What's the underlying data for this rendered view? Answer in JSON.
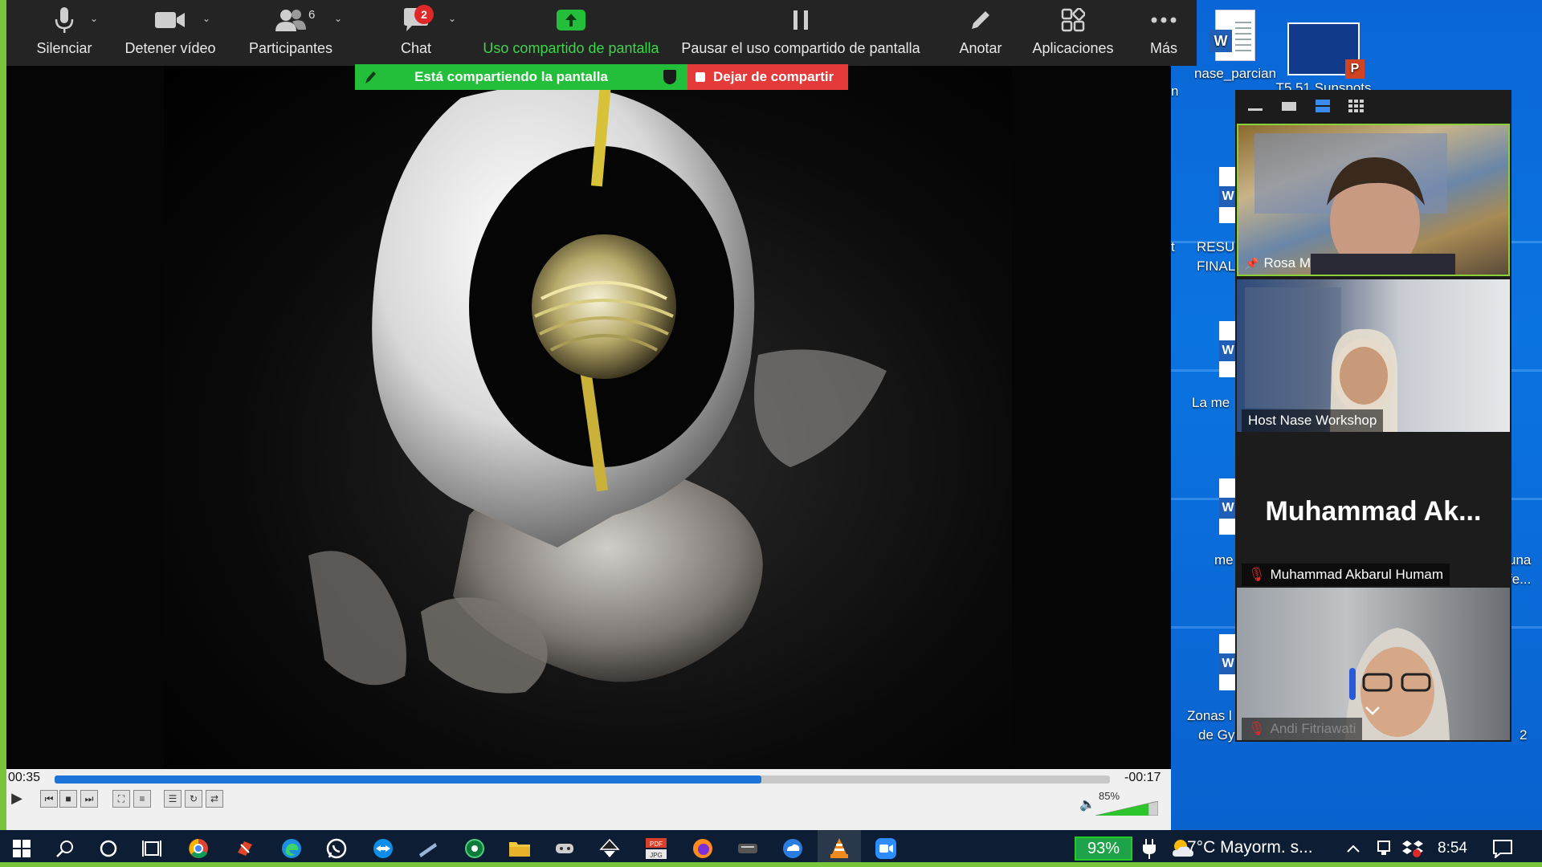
{
  "toolbar": {
    "mute": "Silenciar",
    "stop_video": "Detener vídeo",
    "participants": "Participantes",
    "participants_count": "6",
    "chat": "Chat",
    "chat_badge": "2",
    "share_screen": "Uso compartido de pantalla",
    "pause_share": "Pausar el uso compartido de pantalla",
    "annotate": "Anotar",
    "apps": "Aplicaciones",
    "more": "Más"
  },
  "share_banner": {
    "status": "Está compartiendo la pantalla",
    "stop": "Dejar de compartir"
  },
  "desktop": {
    "icon_doc": "nase_parcian",
    "icon_ppt": "T5 51 Sunspots",
    "frag_n": "n",
    "frag_resul": "RESUL",
    "frag_final": "FINAL",
    "frag_t": "t",
    "frag_la_me": "La me",
    "frag_me": "me",
    "frag_una": "una",
    "frag_fe": "fe...",
    "frag_zonas": "Zonas l",
    "frag_de_gy": "de Gy",
    "frag_2": "2"
  },
  "participants": {
    "tiles": [
      {
        "name": "Rosa M"
      },
      {
        "name": "Host Nase Workshop"
      },
      {
        "display": "Muhammad  Ak...",
        "name": "Muhammad Akbarul Humam"
      },
      {
        "name": "Andi Fitriawati"
      }
    ]
  },
  "vlc": {
    "elapsed": "00:35",
    "remaining": "-00:17",
    "progress": 0.67,
    "volume": "85%"
  },
  "taskbar": {
    "battery": "93%",
    "weather": "7°C  Mayorm. s...",
    "time": "8:54"
  },
  "colors": {
    "share_green": "#23bf3b",
    "stop_red": "#e53a3a",
    "border_green": "#78c43a",
    "toolbar_bg": "#242424"
  }
}
